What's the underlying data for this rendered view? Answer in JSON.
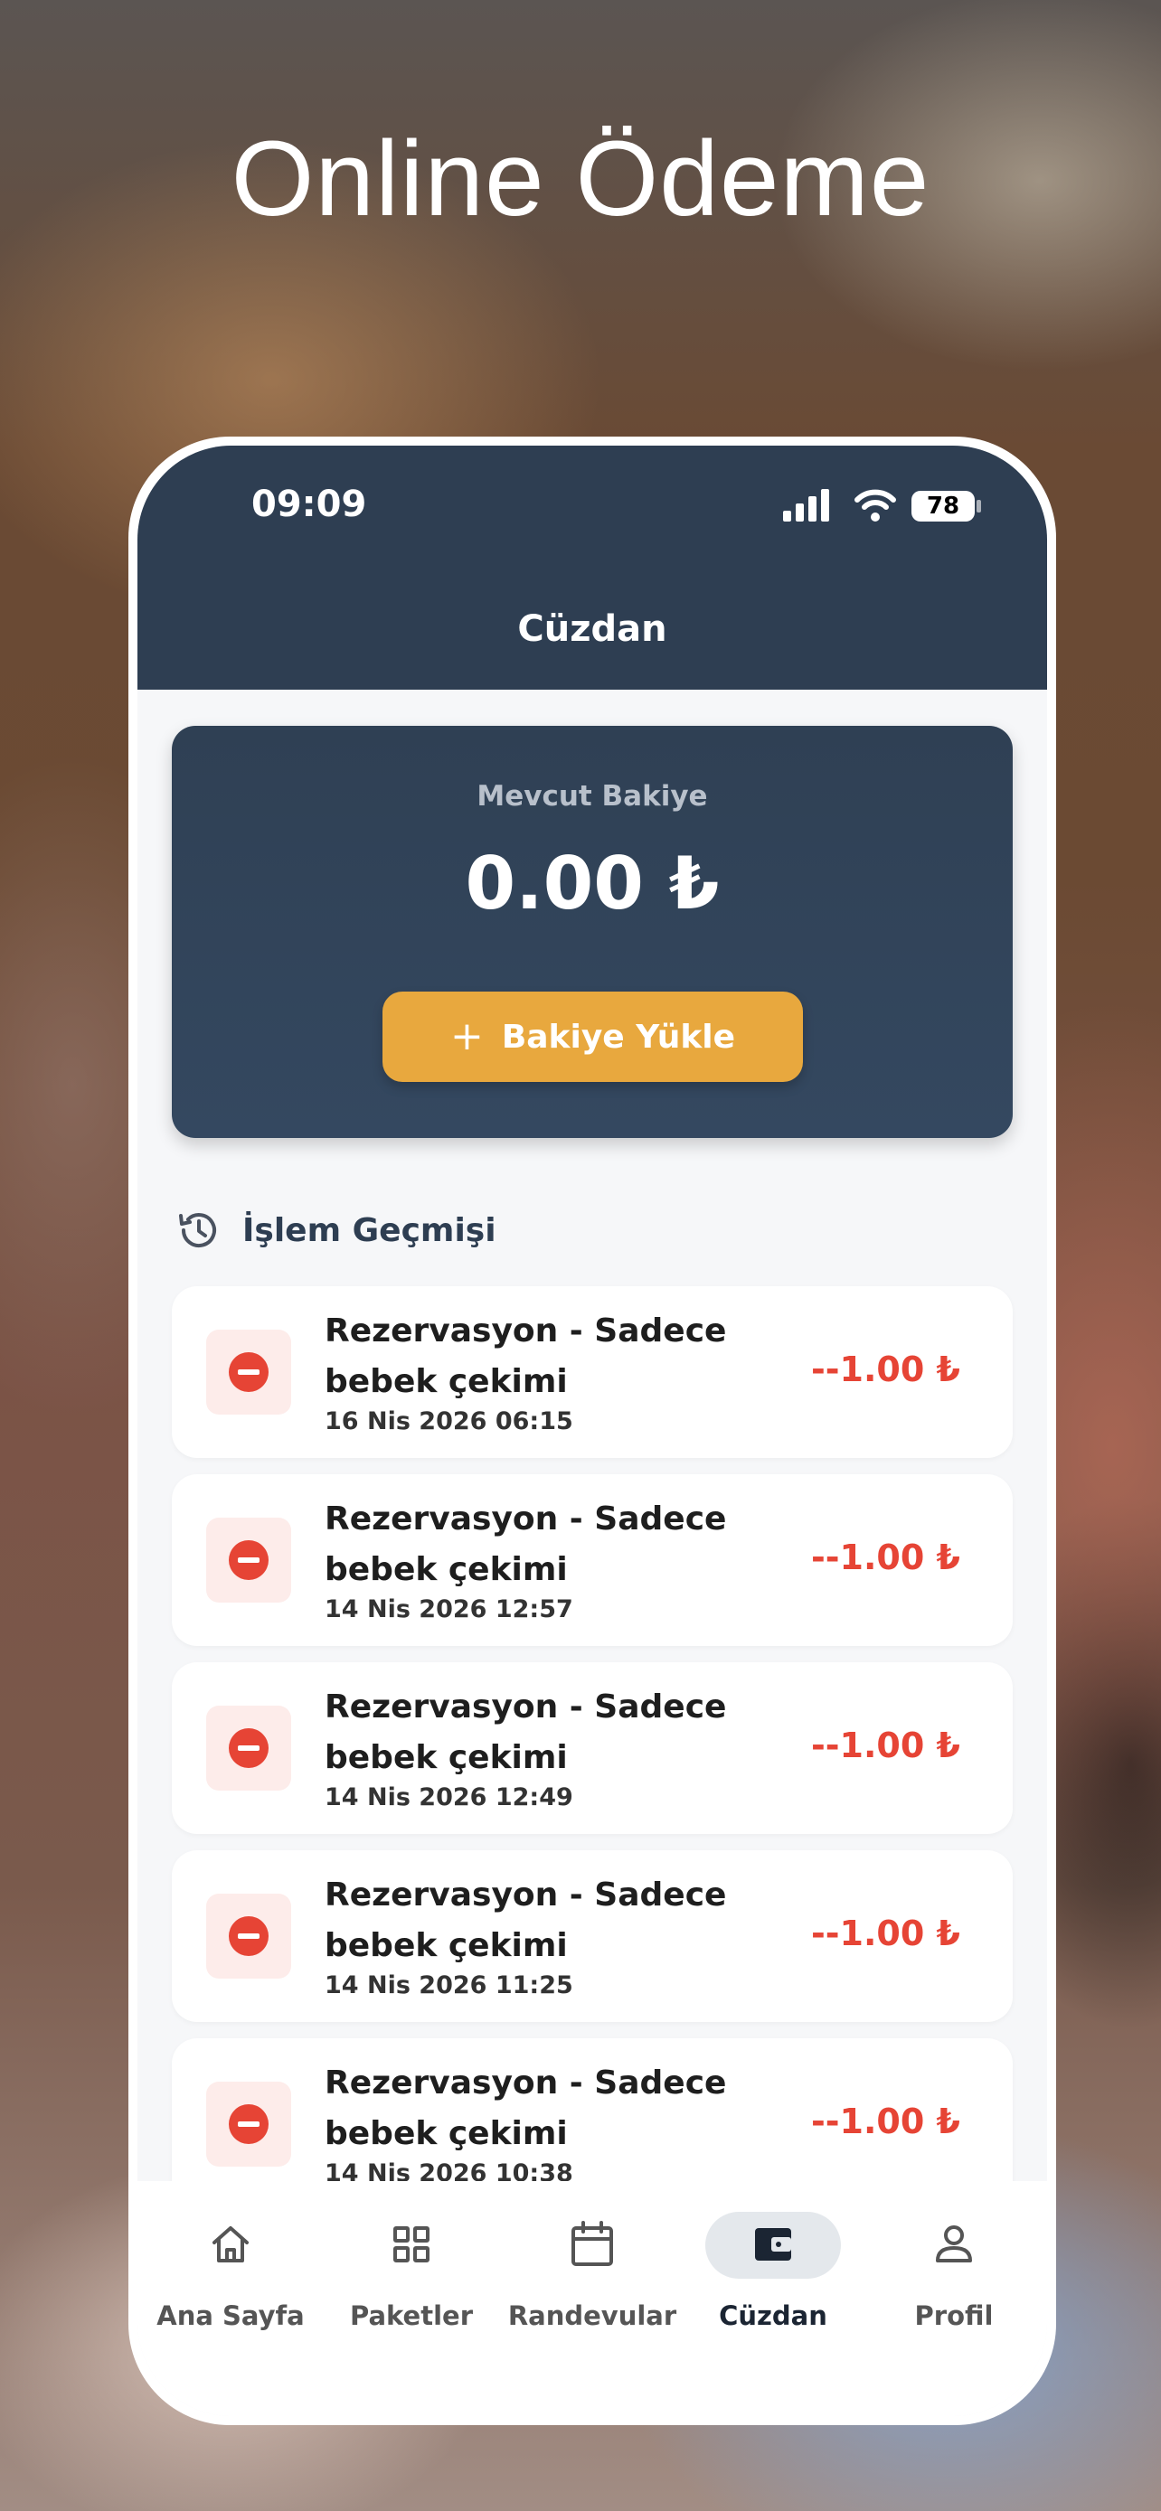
{
  "headline": "Online Ödeme",
  "status_bar": {
    "time": "09:09",
    "battery": "78"
  },
  "header": {
    "title": "Cüzdan"
  },
  "balance": {
    "label": "Mevcut Bakiye",
    "amount": "0.00 ₺",
    "topup_label": "Bakiye Yükle"
  },
  "history": {
    "title": "İşlem Geçmişi",
    "transactions": [
      {
        "title": "Rezervasyon - Sadece bebek çekimi",
        "date": "16 Nis 2026 06:15",
        "amount": "--1.00 ₺"
      },
      {
        "title": "Rezervasyon - Sadece bebek çekimi",
        "date": "14 Nis 2026 12:57",
        "amount": "--1.00 ₺"
      },
      {
        "title": "Rezervasyon - Sadece bebek çekimi",
        "date": "14 Nis 2026 12:49",
        "amount": "--1.00 ₺"
      },
      {
        "title": "Rezervasyon - Sadece bebek çekimi",
        "date": "14 Nis 2026 11:25",
        "amount": "--1.00 ₺"
      },
      {
        "title": "Rezervasyon - Sadece bebek çekimi",
        "date": "14 Nis 2026 10:38",
        "amount": "--1.00 ₺"
      }
    ]
  },
  "tabs": [
    {
      "label": "Ana Sayfa",
      "icon": "home-icon",
      "active": false
    },
    {
      "label": "Paketler",
      "icon": "grid-icon",
      "active": false
    },
    {
      "label": "Randevular",
      "icon": "calendar-icon",
      "active": false
    },
    {
      "label": "Cüzdan",
      "icon": "wallet-icon",
      "active": true
    },
    {
      "label": "Profil",
      "icon": "user-icon",
      "active": false
    }
  ],
  "colors": {
    "header": "#2e3e52",
    "accent": "#e8a83e",
    "negative": "#e64435"
  }
}
